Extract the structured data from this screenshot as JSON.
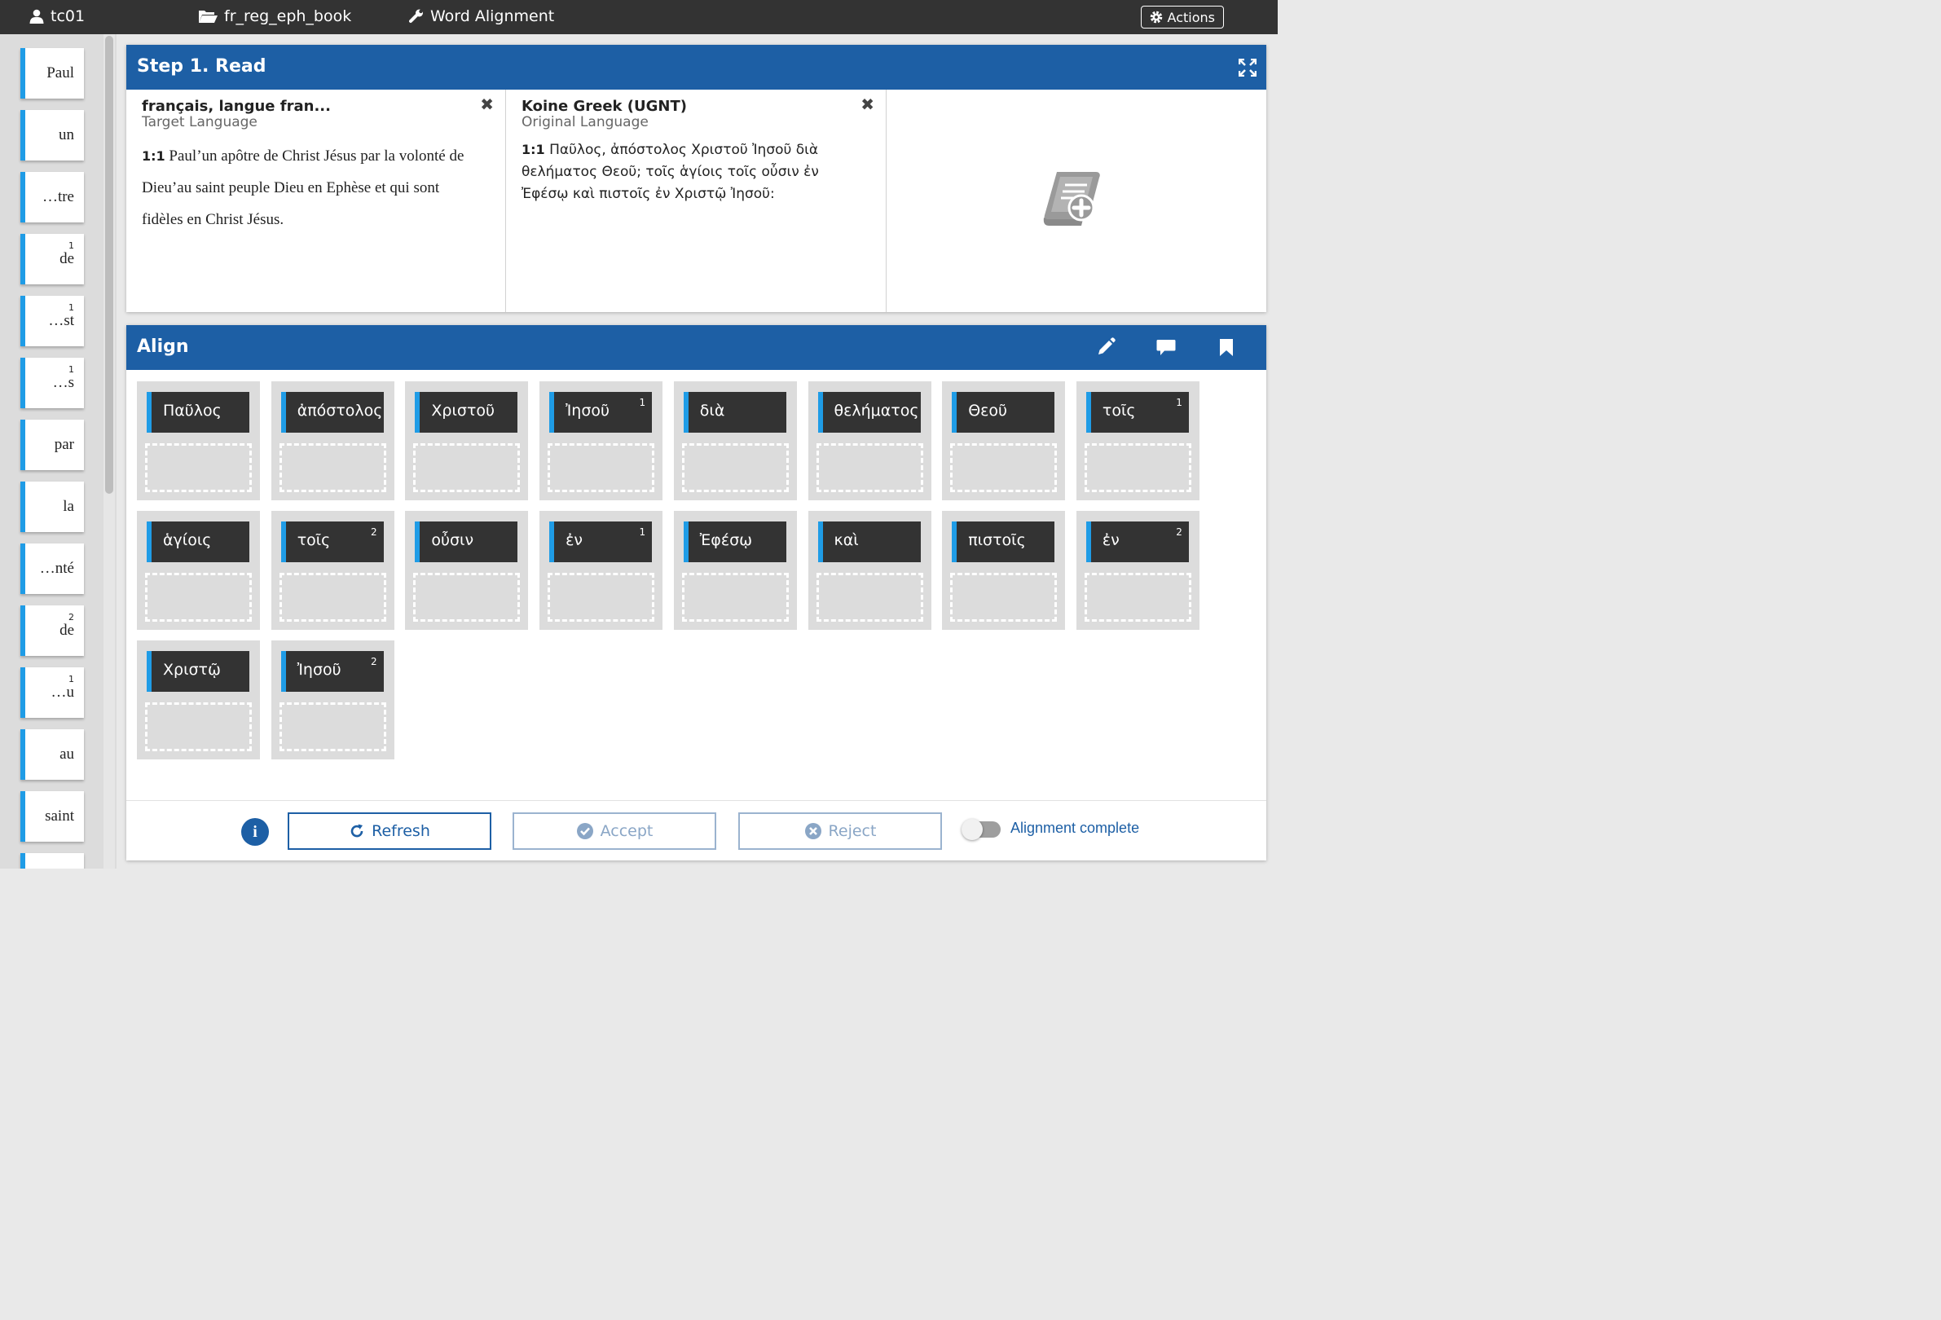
{
  "topbar": {
    "user": "tc01",
    "project": "fr_reg_eph_book",
    "tool": "Word Alignment",
    "actions": "Actions"
  },
  "sidebar": {
    "words": [
      {
        "text": "Paul",
        "sup": ""
      },
      {
        "text": "un",
        "sup": ""
      },
      {
        "text": "…tre",
        "sup": ""
      },
      {
        "text": "de",
        "sup": "1"
      },
      {
        "text": "…st",
        "sup": "1"
      },
      {
        "text": "…s",
        "sup": "1"
      },
      {
        "text": "par",
        "sup": ""
      },
      {
        "text": "la",
        "sup": ""
      },
      {
        "text": "…nté",
        "sup": ""
      },
      {
        "text": "de",
        "sup": "2"
      },
      {
        "text": "…u",
        "sup": "1"
      },
      {
        "text": "au",
        "sup": ""
      },
      {
        "text": "saint",
        "sup": ""
      }
    ]
  },
  "read": {
    "title": "Step 1. Read",
    "target": {
      "title": "français, langue fran...",
      "subtitle": "Target Language",
      "ref": "1:1",
      "text": "Paul’un apôtre de Christ Jésus par la volonté de Dieu’au saint peuple Dieu en Ephèse et qui sont fidèles en Christ Jésus."
    },
    "original": {
      "title": "Koine Greek (UGNT)",
      "subtitle": "Original Language",
      "ref": "1:1",
      "text": "Παῦλος, ἀπόστολος Χριστοῦ Ἰησοῦ διὰ θελήματος Θεοῦ; τοῖς ἁγίοις τοῖς οὖσιν ἐν Ἐφέσῳ καὶ πιστοῖς ἐν Χριστῷ Ἰησοῦ:"
    },
    "close_glyph": "✖"
  },
  "align": {
    "title": "Align",
    "words": [
      {
        "text": "Παῦλος",
        "sup": ""
      },
      {
        "text": "ἀπόστολος",
        "sup": ""
      },
      {
        "text": "Χριστοῦ",
        "sup": ""
      },
      {
        "text": "Ἰησοῦ",
        "sup": "1"
      },
      {
        "text": "διὰ",
        "sup": ""
      },
      {
        "text": "θελήματος",
        "sup": ""
      },
      {
        "text": "Θεοῦ",
        "sup": ""
      },
      {
        "text": "τοῖς",
        "sup": "1"
      },
      {
        "text": "ἁγίοις",
        "sup": ""
      },
      {
        "text": "τοῖς",
        "sup": "2"
      },
      {
        "text": "οὖσιν",
        "sup": ""
      },
      {
        "text": "ἐν",
        "sup": "1"
      },
      {
        "text": "Ἐφέσῳ",
        "sup": ""
      },
      {
        "text": "καὶ",
        "sup": ""
      },
      {
        "text": "πιστοῖς",
        "sup": ""
      },
      {
        "text": "ἐν",
        "sup": "2"
      },
      {
        "text": "Χριστῷ",
        "sup": ""
      },
      {
        "text": "Ἰησοῦ",
        "sup": "2"
      }
    ]
  },
  "footer": {
    "info": "i",
    "refresh": "Refresh",
    "accept": "Accept",
    "reject": "Reject",
    "toggle_label": "Alignment complete",
    "toggle_on": false
  },
  "colors": {
    "header_blue": "#1d5fa5",
    "accent_blue": "#1f9ce6",
    "topbar": "#333333",
    "card_dark": "#333333"
  }
}
